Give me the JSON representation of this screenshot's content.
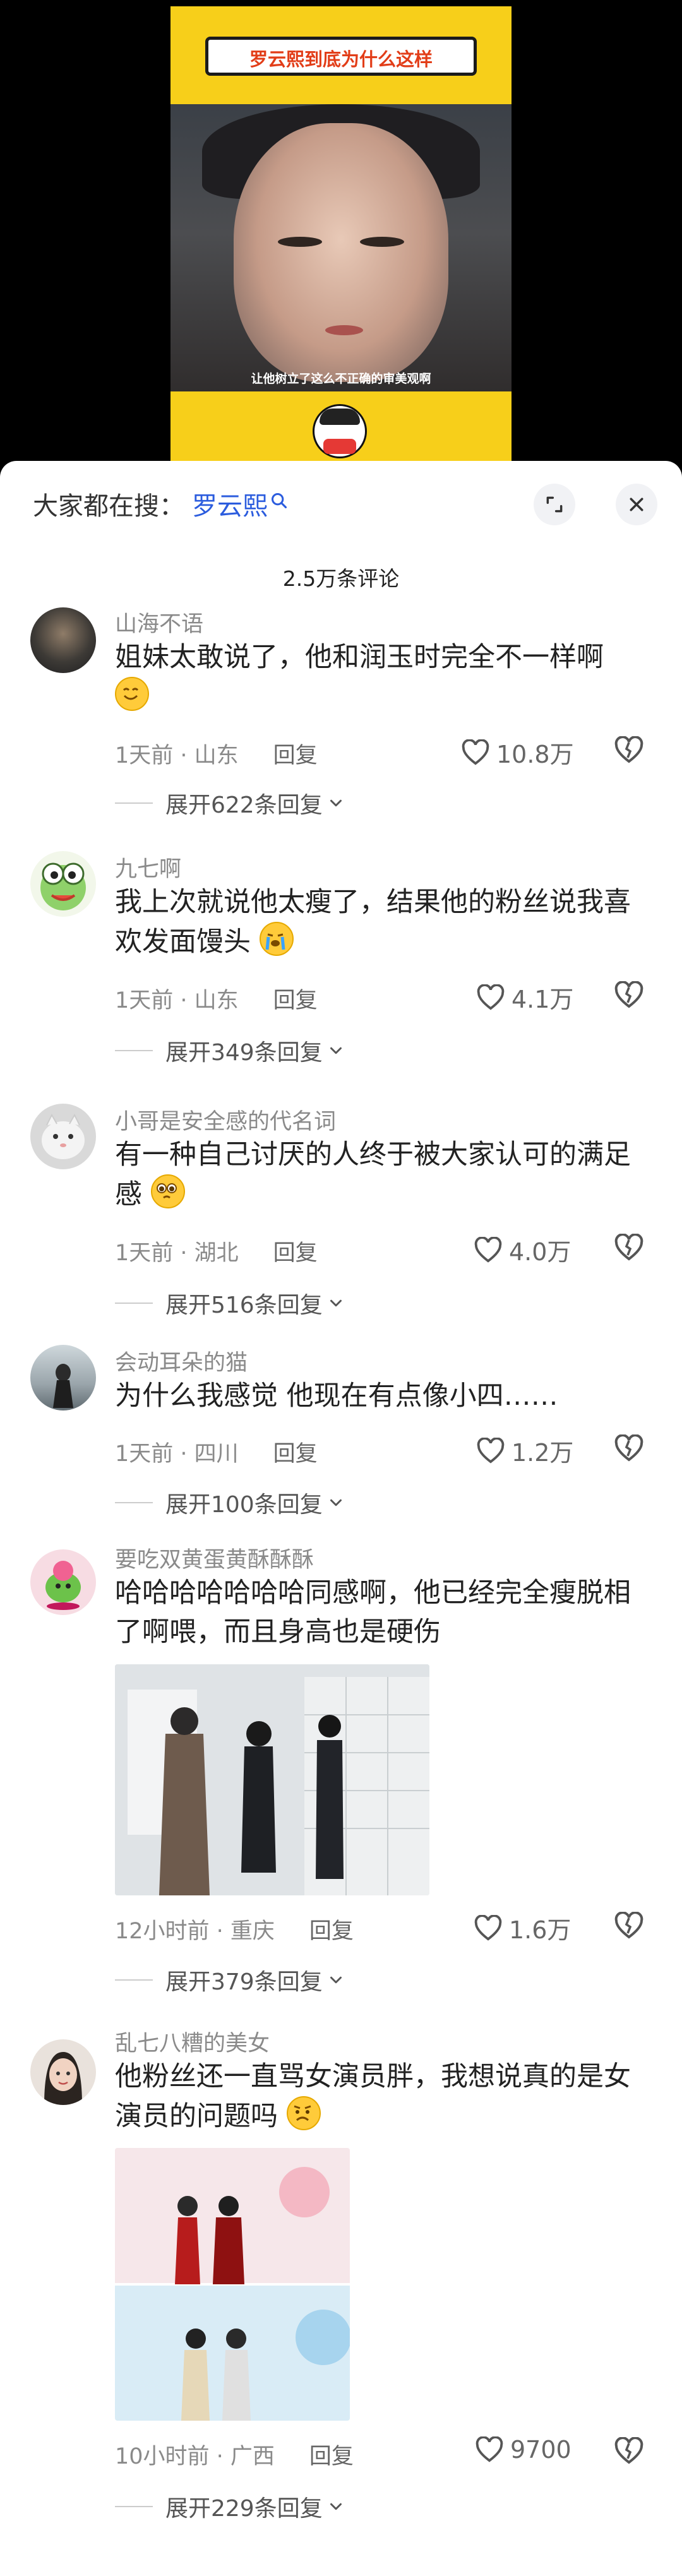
{
  "video": {
    "title": "罗云熙到底为什么这样",
    "subtitle": "让他树立了这么不正确的审美观啊"
  },
  "sheet": {
    "search_label": "大家都在搜：",
    "search_term": "罗云熙",
    "comment_count": "2.5万条评论",
    "reply_label": "回复"
  },
  "comments": [
    {
      "user": "山海不语",
      "text": "姐妹太敢说了，他和润玉时完全不一样啊",
      "emoji": "smile-emoji",
      "time": "1天前 · 山东",
      "likes": "10.8万",
      "expand": "展开622条回复"
    },
    {
      "user": "九七啊",
      "text": "我上次就说他太瘦了，结果他的粉丝说我喜欢发面馒头",
      "emoji": "crying-emoji",
      "time": "1天前 · 山东",
      "likes": "4.1万",
      "expand": "展开349条回复"
    },
    {
      "user": "小哥是安全感的代名词",
      "text": "有一种自己讨厌的人终于被大家认可的满足感",
      "emoji": "teary-emoji",
      "time": "1天前 · 湖北",
      "likes": "4.0万",
      "expand": "展开516条回复"
    },
    {
      "user": "会动耳朵的猫",
      "text": "为什么我感觉 他现在有点像小四……",
      "emoji": "",
      "time": "1天前 · 四川",
      "likes": "1.2万",
      "expand": "展开100条回复"
    },
    {
      "user": "要吃双黄蛋黄酥酥酥",
      "text": "哈哈哈哈哈哈哈同感啊，他已经完全瘦脱相了啊喂，而且身高也是硬伤",
      "emoji": "",
      "time": "12小时前 · 重庆",
      "likes": "1.6万",
      "expand": "展开379条回复"
    },
    {
      "user": "乱七八糟的美女",
      "text": "他粉丝还一直骂女演员胖，我想说真的是女演员的问题吗",
      "emoji": "worried-emoji",
      "time": "10小时前 · 广西",
      "likes": "9700",
      "expand": "展开229条回复"
    }
  ],
  "colors": {
    "accent": "#2b5cde",
    "video_bg": "#f7cf1a"
  }
}
